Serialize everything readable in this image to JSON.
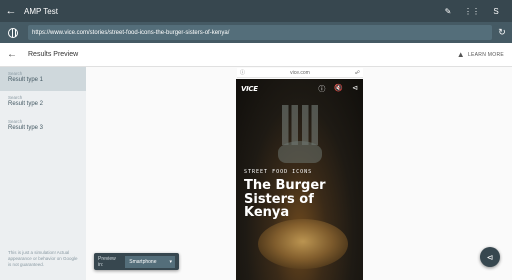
{
  "app": {
    "title": "AMP Test",
    "account_initial": "S"
  },
  "urlbar": {
    "url": "https://www.vice.com/stories/street-food-icons-the-burger-sisters-of-kenya/"
  },
  "page": {
    "title": "Results Preview",
    "learn_more": "LEARN MORE"
  },
  "sidebar": {
    "items": [
      {
        "label": "Search",
        "value": "Result type 1",
        "active": true
      },
      {
        "label": "Search",
        "value": "Result type 2",
        "active": false
      },
      {
        "label": "Search",
        "value": "Result type 3",
        "active": false
      }
    ],
    "note": "This is just a simulation! Actual appearance or behavior on Google is not guaranteed."
  },
  "preview": {
    "domain": "vice.com",
    "brand": "VICE",
    "kicker": "STREET FOOD ICONS",
    "headline": "The Burger Sisters of Kenya"
  },
  "device": {
    "label": "Preview in:",
    "selected": "Smartphone"
  },
  "colors": {
    "header": "#37474f",
    "urlbar": "#455a64",
    "sidebar": "#eceff1",
    "sidebar_active": "#cfd8dc"
  },
  "icons": [
    "arrow-back-icon",
    "feedback-icon",
    "apps-grid-icon",
    "globe-icon",
    "refresh-icon",
    "school-cap-icon",
    "info-icon",
    "mute-icon",
    "share-icon",
    "dropdown-icon"
  ]
}
